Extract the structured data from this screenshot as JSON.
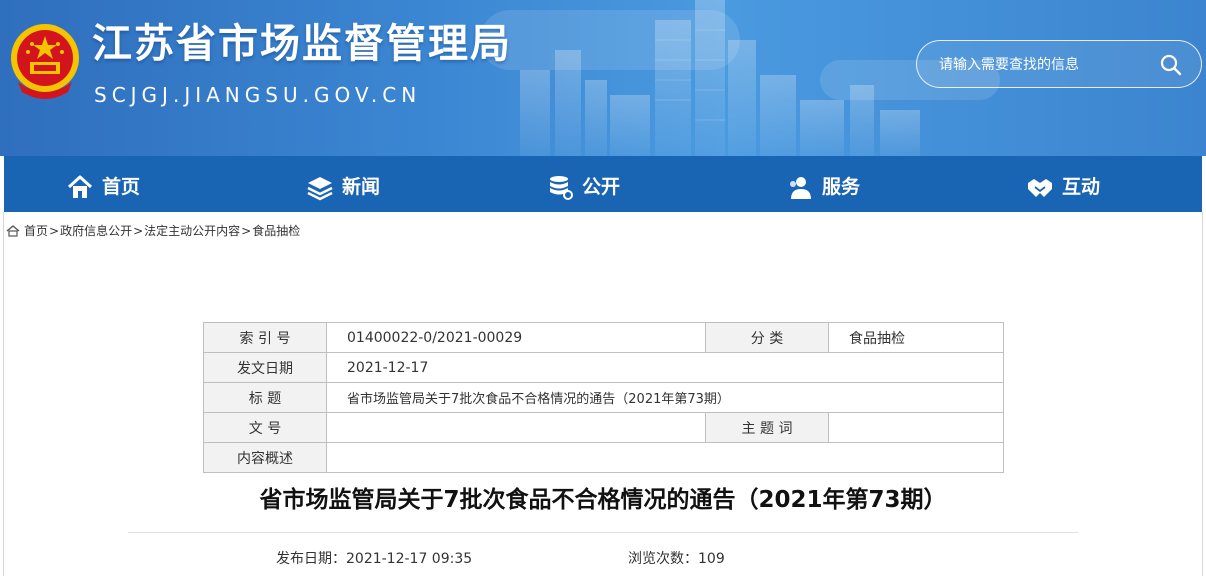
{
  "header": {
    "title": "江苏省市场监督管理局",
    "domain": "SCJGJ.JIANGSU.GOV.CN",
    "emblem_icon": "national-emblem-icon",
    "search": {
      "placeholder": "请输入需要查找的信息",
      "icon": "search-icon"
    }
  },
  "nav": {
    "items": [
      {
        "label": "首页",
        "icon": "home-icon"
      },
      {
        "label": "新闻",
        "icon": "layers-icon"
      },
      {
        "label": "公开",
        "icon": "database-icon"
      },
      {
        "label": "服务",
        "icon": "users-icon"
      },
      {
        "label": "互动",
        "icon": "handshake-icon"
      }
    ]
  },
  "breadcrumb": {
    "items": [
      "首页",
      "政府信息公开",
      "法定主动公开内容",
      "食品抽检"
    ],
    "separator": ">"
  },
  "info_table": {
    "index_label": "索 引 号",
    "index_value": "01400022-0/2021-00029",
    "category_label": "分 类",
    "category_value": "食品抽检",
    "date_label": "发文日期",
    "date_value": "2021-12-17",
    "title_label": "标 题",
    "title_value": "省市场监管局关于7批次食品不合格情况的通告（2021年第73期）",
    "doc_no_label": "文 号",
    "doc_no_value": "",
    "keywords_label": "主 题 词",
    "keywords_value": "",
    "summary_label": "内容概述",
    "summary_value": ""
  },
  "article": {
    "title": "省市场监管局关于7批次食品不合格情况的通告（2021年第73期）",
    "publish_label": "发布日期：",
    "publish_value": "2021-12-17 09:35",
    "views_label": "浏览次数：",
    "views_value": "109"
  },
  "colors": {
    "header_blue": "#3b86d2",
    "nav_blue": "#1a64b4",
    "table_label_bg": "#f2f2f2",
    "emblem_red": "#d4141c",
    "emblem_gold": "#f5c400"
  }
}
